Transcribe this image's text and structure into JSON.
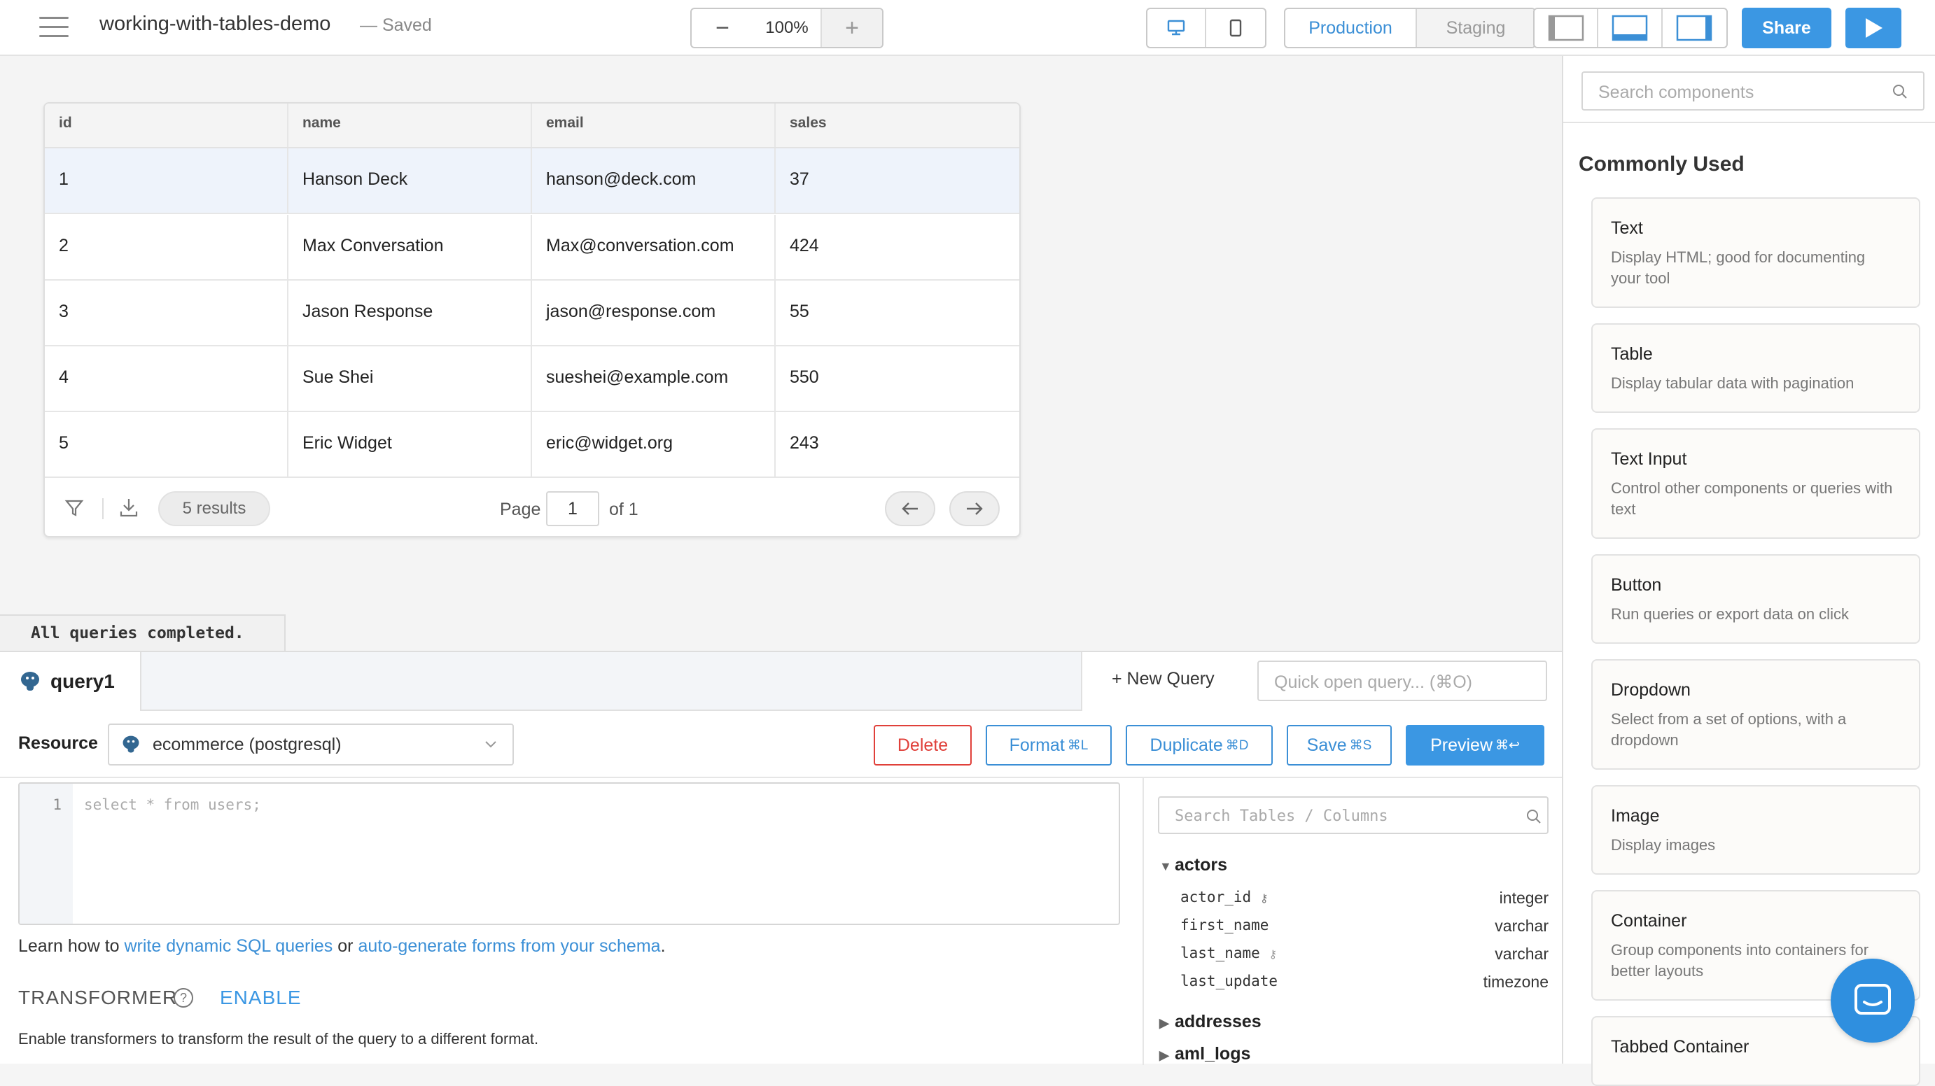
{
  "app": {
    "title": "working-with-tables-demo",
    "save_status": "— Saved"
  },
  "toolbar": {
    "zoom_minus": "−",
    "zoom_value": "100%",
    "zoom_plus": "+",
    "env_production": "Production",
    "env_staging": "Staging",
    "share": "Share"
  },
  "table": {
    "columns": [
      "id",
      "name",
      "email",
      "sales"
    ],
    "rows": [
      [
        "1",
        "Hanson Deck",
        "hanson@deck.com",
        "37"
      ],
      [
        "2",
        "Max Conversation",
        "Max@conversation.com",
        "424"
      ],
      [
        "3",
        "Jason Response",
        "jason@response.com",
        "55"
      ],
      [
        "4",
        "Sue Shei",
        "sueshei@example.com",
        "550"
      ],
      [
        "5",
        "Eric Widget",
        "eric@widget.org",
        "243"
      ]
    ],
    "results": "5 results",
    "page_label": "Page",
    "page_value": "1",
    "of_label": "of 1"
  },
  "status": {
    "message": "All queries completed."
  },
  "query": {
    "tab_name": "query1",
    "new_query": "+ New Query",
    "quick_open_placeholder": "Quick open query... (⌘O)",
    "resource_label": "Resource",
    "resource_value": "ecommerce (postgresql)",
    "delete": "Delete",
    "format": "Format",
    "format_key": "⌘L",
    "duplicate": "Duplicate",
    "duplicate_key": "⌘D",
    "save": "Save",
    "save_key": "⌘S",
    "preview": "Preview",
    "preview_key": "⌘↩",
    "line_number": "1",
    "code": "select * from users;",
    "learn_prefix": "Learn how to ",
    "learn_link1": "write dynamic SQL queries",
    "learn_mid": " or ",
    "learn_link2": "auto-generate forms from your schema",
    "learn_suffix": ".",
    "transformer_title": "TRANSFORMER",
    "transformer_enable": "ENABLE",
    "transformer_desc": "Enable transformers to transform the result of the query to a different format."
  },
  "schema": {
    "search_placeholder": "Search Tables / Columns",
    "tables": [
      {
        "name": "actors",
        "expanded": true,
        "columns": [
          {
            "name": "actor_id",
            "type": "integer"
          },
          {
            "name": "first_name",
            "type": "varchar"
          },
          {
            "name": "last_name",
            "type": "varchar"
          },
          {
            "name": "last_update",
            "type": "timezone"
          }
        ]
      },
      {
        "name": "addresses",
        "expanded": false
      },
      {
        "name": "aml_logs",
        "expanded": false
      }
    ]
  },
  "sidebar": {
    "search_placeholder": "Search components",
    "section_title": "Commonly Used",
    "components": [
      {
        "title": "Text",
        "desc": "Display HTML; good for documenting your tool"
      },
      {
        "title": "Table",
        "desc": "Display tabular data with pagination"
      },
      {
        "title": "Text Input",
        "desc": "Control other components or queries with text"
      },
      {
        "title": "Button",
        "desc": "Run queries or export data on click"
      },
      {
        "title": "Dropdown",
        "desc": "Select from a set of options, with a dropdown"
      },
      {
        "title": "Image",
        "desc": "Display images"
      },
      {
        "title": "Container",
        "desc": "Group components into containers for better layouts"
      },
      {
        "title": "Tabbed Container",
        "desc": ""
      }
    ]
  },
  "colors": {
    "accent": "#3b97e3",
    "danger": "#e0403a"
  }
}
